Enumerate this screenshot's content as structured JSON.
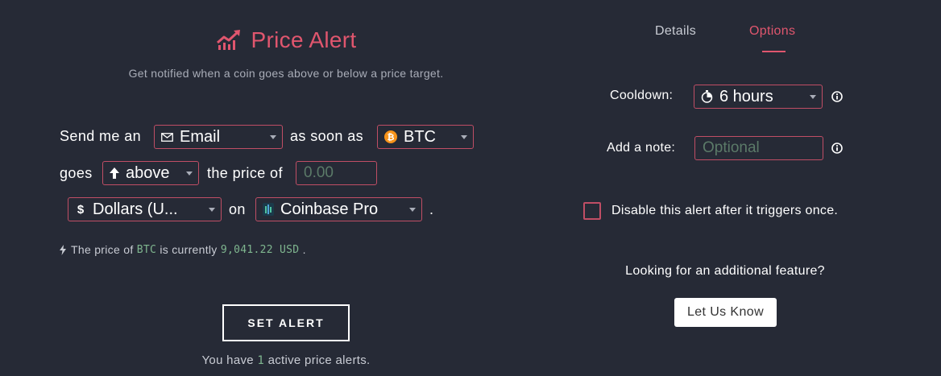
{
  "header": {
    "title": "Price Alert",
    "subtitle": "Get notified when a coin goes above or below a price target."
  },
  "sentence": {
    "send_me_an": "Send me an",
    "as_soon_as": "as soon as",
    "goes": "goes",
    "the_price_of": "the price of",
    "on": "on",
    "period": "."
  },
  "notify_method": {
    "value": "Email",
    "icon": "envelope-icon"
  },
  "coin": {
    "value": "BTC",
    "icon": "bitcoin-icon"
  },
  "direction": {
    "value": "above",
    "icon": "arrow-up-icon"
  },
  "price_input": {
    "placeholder": "0.00",
    "value": ""
  },
  "currency": {
    "value": "Dollars (U...",
    "icon": "dollar-icon"
  },
  "exchange": {
    "value": "Coinbase Pro",
    "icon": "coinbase-pro-icon"
  },
  "price_info": {
    "prefix": "The price of",
    "coin": "BTC",
    "middle": "is currently",
    "price": "9,041.22 USD",
    "suffix": "."
  },
  "set_alert_button": "SET ALERT",
  "active_alerts": {
    "prefix": "You have",
    "count": "1",
    "suffix": "active price alerts."
  },
  "tabs": [
    {
      "label": "Details",
      "active": false
    },
    {
      "label": "Options",
      "active": true
    }
  ],
  "options": {
    "cooldown_label": "Cooldown:",
    "cooldown_value": "6 hours",
    "note_label": "Add a note:",
    "note_placeholder": "Optional",
    "note_value": "",
    "disable_label": "Disable this alert after it triggers once.",
    "disable_checked": false,
    "feature_question": "Looking for an additional feature?",
    "let_us_know": "Let Us Know"
  },
  "colors": {
    "background": "#262a36",
    "accent": "#e0566e",
    "border": "#c04e65",
    "mono_green": "#7fb68f",
    "bitcoin_orange": "#f7931a"
  }
}
